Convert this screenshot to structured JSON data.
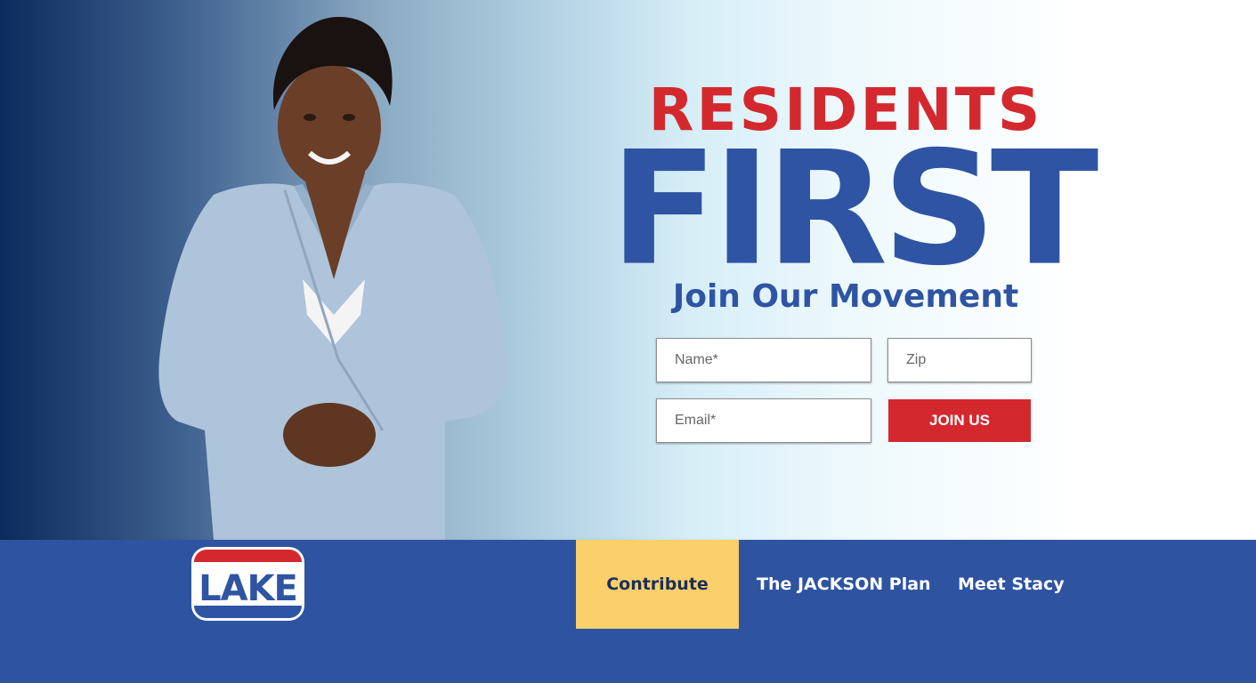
{
  "hero": {
    "line1": "RESIDENTS",
    "line2": "FIRST",
    "subtitle": "Join Our Movement",
    "colors": {
      "red": "#d4282f",
      "blue": "#2e54a3"
    }
  },
  "form": {
    "name_placeholder": "Name*",
    "zip_placeholder": "Zip",
    "email_placeholder": "Email*",
    "submit_label": "JOIN US"
  },
  "nav": {
    "logo_text": "LAKE",
    "items": [
      {
        "label": "Contribute"
      },
      {
        "label": "The JACKSON Plan"
      },
      {
        "label": "Meet Stacy"
      }
    ],
    "colors": {
      "bar": "#2e53a0",
      "highlight": "#fbd06a"
    }
  }
}
